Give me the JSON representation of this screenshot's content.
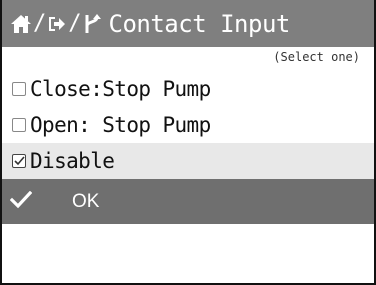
{
  "header": {
    "icons": [
      "home-icon",
      "login-arrow-icon",
      "fork-icon"
    ],
    "separator": "/",
    "title": "Contact Input"
  },
  "hint": "(Select one)",
  "options": [
    {
      "label": "Close:Stop Pump",
      "checked": false
    },
    {
      "label": "Open: Stop Pump",
      "checked": false
    },
    {
      "label": "Disable",
      "checked": true
    }
  ],
  "ok": {
    "icon": "checkmark-icon",
    "label": "OK"
  },
  "colors": {
    "title_bar": "#7f7f7f",
    "ok_bar": "#6f6f6f",
    "selected_row": "#e8e8e8"
  }
}
